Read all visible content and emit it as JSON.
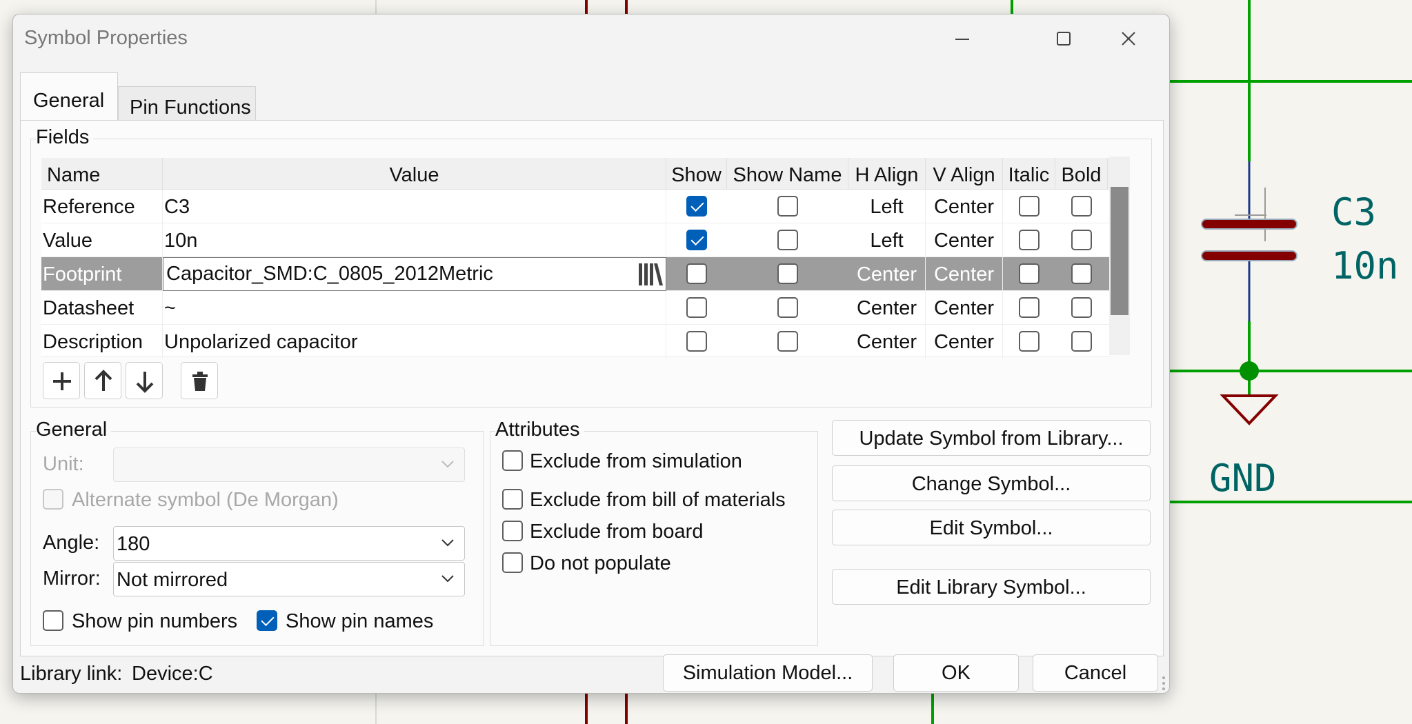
{
  "window": {
    "title": "Symbol Properties"
  },
  "tabs": [
    {
      "label": "General"
    },
    {
      "label": "Pin Functions"
    }
  ],
  "fields": {
    "group_label": "Fields",
    "columns": [
      "Name",
      "Value",
      "Show",
      "Show Name",
      "H Align",
      "V Align",
      "Italic",
      "Bold"
    ],
    "rows": [
      {
        "name": "Reference",
        "value": "C3",
        "show": true,
        "show_name": false,
        "h_align": "Left",
        "v_align": "Center",
        "italic": false,
        "bold": false
      },
      {
        "name": "Value",
        "value": "10n",
        "show": true,
        "show_name": false,
        "h_align": "Left",
        "v_align": "Center",
        "italic": false,
        "bold": false
      },
      {
        "name": "Footprint",
        "value": "Capacitor_SMD:C_0805_2012Metric",
        "show": false,
        "show_name": false,
        "h_align": "Center",
        "v_align": "Center",
        "italic": false,
        "bold": false,
        "selected": true
      },
      {
        "name": "Datasheet",
        "value": "~",
        "show": false,
        "show_name": false,
        "h_align": "Center",
        "v_align": "Center",
        "italic": false,
        "bold": false
      },
      {
        "name": "Description",
        "value": "Unpolarized capacitor",
        "show": false,
        "show_name": false,
        "h_align": "Center",
        "v_align": "Center",
        "italic": false,
        "bold": false
      }
    ],
    "toolbar_icons": [
      "plus-icon",
      "arrow-up-icon",
      "arrow-down-icon",
      "trash-icon"
    ]
  },
  "general": {
    "group_label": "General",
    "unit_label": "Unit:",
    "unit_value": "",
    "alternate_label": "Alternate symbol (De Morgan)",
    "angle_label": "Angle:",
    "angle_value": "180",
    "mirror_label": "Mirror:",
    "mirror_value": "Not mirrored",
    "show_pin_numbers_label": "Show pin numbers",
    "show_pin_numbers": false,
    "show_pin_names_label": "Show pin names",
    "show_pin_names": true
  },
  "attributes": {
    "group_label": "Attributes",
    "items": [
      {
        "label": "Exclude from simulation",
        "checked": false
      },
      {
        "label": "Exclude from bill of materials",
        "checked": false
      },
      {
        "label": "Exclude from board",
        "checked": false
      },
      {
        "label": "Do not populate",
        "checked": false
      }
    ]
  },
  "actions": {
    "update_symbol": "Update Symbol from Library...",
    "change_symbol": "Change Symbol...",
    "edit_symbol": "Edit Symbol...",
    "edit_library_symbol": "Edit Library Symbol..."
  },
  "footer": {
    "library_link_label": "Library link:",
    "library_link_value": "Device:C",
    "simulation_model": "Simulation Model...",
    "ok": "OK",
    "cancel": "Cancel"
  },
  "schematic": {
    "ref": "C3",
    "value": "10n",
    "ground_label": "GND",
    "colors": {
      "wire": "#00a000",
      "symbol": "#840000",
      "text": "#006464",
      "junction": "#009000"
    }
  }
}
